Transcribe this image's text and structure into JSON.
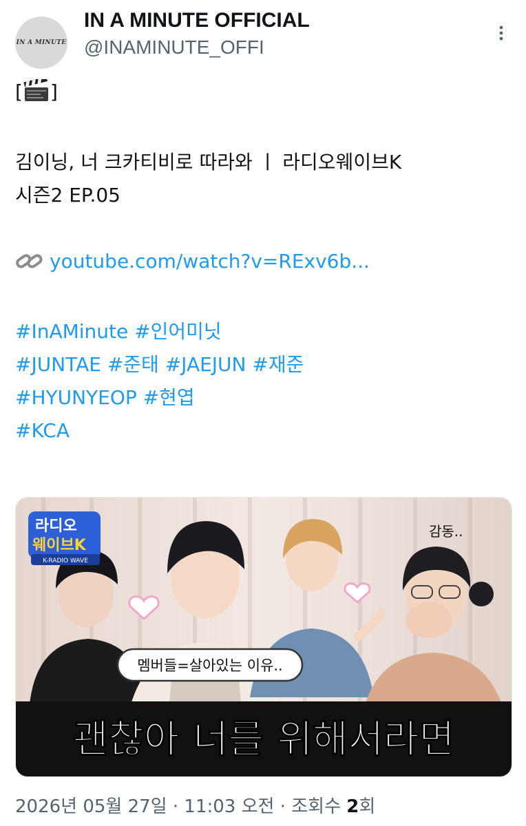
{
  "account": {
    "display_name": "IN A MINUTE OFFICIAL",
    "handle": "@INAMINUTE_OFFI",
    "avatar_text": "IN A MINUTE"
  },
  "tweet": {
    "prefix_open": "[",
    "prefix_close": "]",
    "prefix_icon": "clapper-board-icon",
    "title_line1": "김이닝, 너 크카티비로 따라와 ㅣ  라디오웨이브K",
    "title_line2": "시즌2 EP.05",
    "link_icon": "chain-link-icon",
    "link_text": "youtube.com/watch?v=RExv6b...",
    "hashtag_lines": [
      "#InAMinute #인어미닛",
      "#JUNTAE #준태 #JAEJUN #재준",
      "#HYUNYEOP #현엽",
      "#KCA"
    ]
  },
  "media": {
    "logo_line1": "라디오",
    "logo_line2": "웨이브K",
    "logo_sub": "K-RADIO WAVE",
    "corner_caption": "감동..",
    "speech_bubble": "멤버들=살아있는 이유..",
    "headline": "괜찮아 너를 위해서라면",
    "colors": {
      "background": "#e8dcd6",
      "headline_bar": "#111111",
      "headline_text": "#ffffff",
      "logo_blue": "#2d5fd6",
      "logo_yellow": "#ffd23c"
    }
  },
  "meta": {
    "timestamp": "2026년 05월 27일 · 11:03 오전 · 조회수 ",
    "views_count": "2",
    "views_suffix": "회"
  },
  "icons": {
    "more": "more-dots-icon"
  }
}
